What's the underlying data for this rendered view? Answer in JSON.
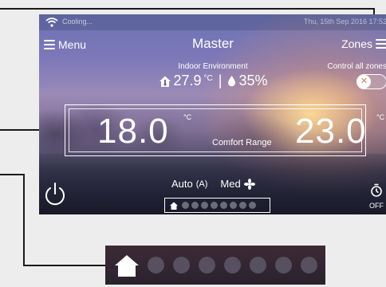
{
  "status": {
    "text": "Cooling...",
    "datetime": "Thu, 15th Sep 2016 17:52"
  },
  "header": {
    "menu_label": "Menu",
    "title": "Master",
    "zones_label": "Zones"
  },
  "indoor": {
    "title": "Indoor Environment",
    "temperature": "27.9",
    "temp_unit": "°C",
    "separator": "|",
    "humidity": "35%"
  },
  "control_all": {
    "label": "Control all zones",
    "state": "off"
  },
  "comfort": {
    "low": "18.0",
    "low_unit": "°C",
    "label": "Comfort Range",
    "high": "23.0",
    "high_unit": "°C"
  },
  "mode": {
    "mode_label": "Auto",
    "mode_icon_text": "(A)",
    "fan_label": "Med"
  },
  "pager": {
    "active_index": 0,
    "page_count": 9
  },
  "timer": {
    "label": "OFF"
  },
  "colors": {
    "toggle_knob_x": "#e07a57",
    "callout_line": "#1a1a1a"
  }
}
